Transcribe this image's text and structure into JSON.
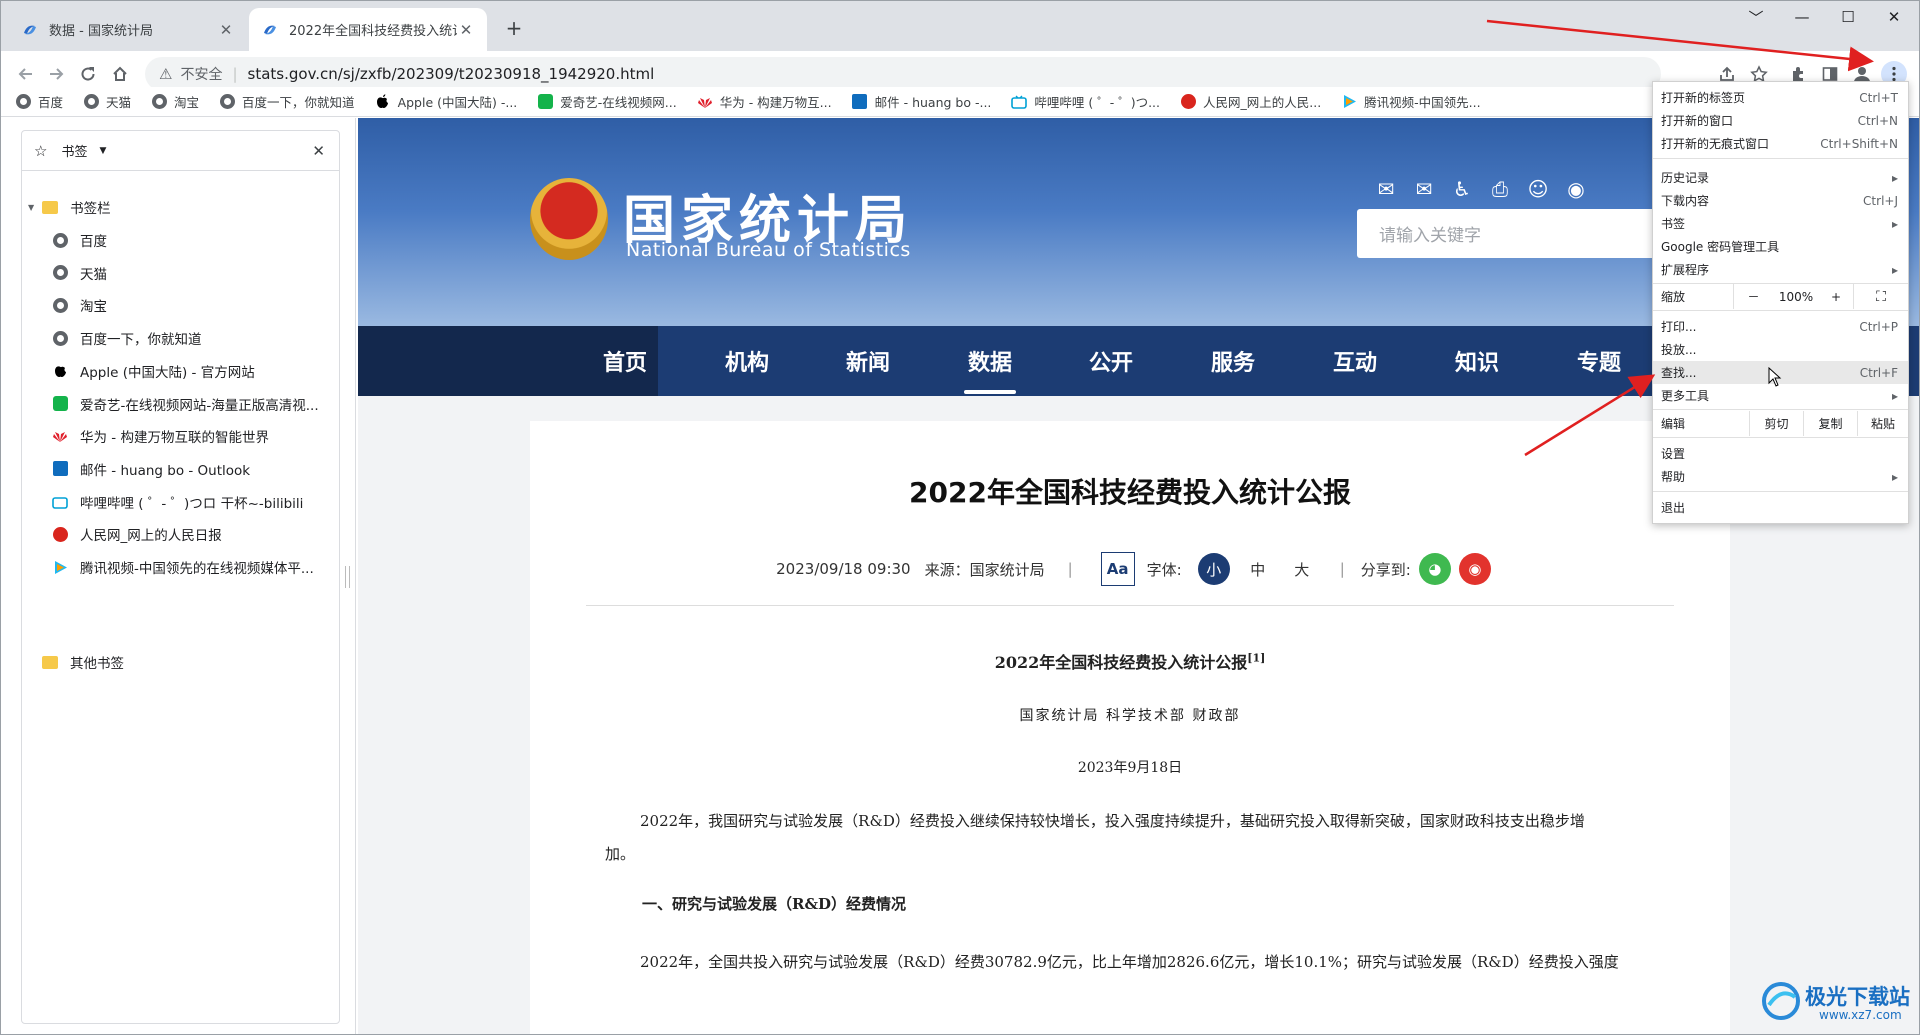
{
  "tabs": [
    {
      "title": "数据 - 国家统计局",
      "close": "✕"
    },
    {
      "title": "2022年全国科技经费投入统计公",
      "close": "✕"
    }
  ],
  "new_tab": "+",
  "window_controls": {
    "minimize": "﹀",
    "restore": "—",
    "maximize": "☐",
    "close": "✕"
  },
  "address_bar": {
    "warning": "⚠",
    "insecure": "不安全",
    "url": "stats.gov.cn/sj/zxfb/202309/t20230918_1942920.html"
  },
  "bookmarks_bar": [
    "百度",
    "天猫",
    "淘宝",
    "百度一下，你就知道",
    "Apple (中国大陆) -...",
    "爱奇艺-在线视频网...",
    "华为 - 构建万物互...",
    "邮件 - huang bo -...",
    "哔哩哔哩 ( ゜- ゜)つ...",
    "人民网_网上的人民...",
    "腾讯视频-中国领先..."
  ],
  "side_panel": {
    "header": "书签",
    "close": "✕",
    "folder": "书签栏",
    "items": [
      "百度",
      "天猫",
      "淘宝",
      "百度一下，你就知道",
      "Apple (中国大陆) - 官方网站",
      "爱奇艺-在线视频网站-海量正版高清视...",
      "华为 - 构建万物互联的智能世界",
      "邮件 - huang bo - Outlook",
      "哔哩哔哩 ( ゜- ゜)つロ 干杯~-bilibili",
      "人民网_网上的人民日报",
      "腾讯视频-中国领先的在线视频媒体平..."
    ],
    "other": "其他书签"
  },
  "site": {
    "logo_cn": "国家统计局",
    "logo_en": "National Bureau of Statistics",
    "search_placeholder": "请输入关键字",
    "nav": [
      "首页",
      "机构",
      "新闻",
      "数据",
      "公开",
      "服务",
      "互动",
      "知识",
      "专题"
    ]
  },
  "article": {
    "title": "2022年全国科技经费投入统计公报",
    "date": "2023/09/18 09:30",
    "source": "来源：国家统计局",
    "divider": "|",
    "aa": "Aa",
    "font_label": "字体:",
    "font_small": "小",
    "font_mid": "中",
    "font_large": "大",
    "share_label": "分享到:",
    "body_title": "2022年全国科技经费投入统计公报",
    "body_title_note": "[1]",
    "authors": "国家统计局 科学技术部 财政部",
    "body_date": "2023年9月18日",
    "para1": "2022年，我国研究与试验发展（R&D）经费投入继续保持较快增长，投入强度持续提升，基础研究投入取得新突破，国家财政科技支出稳步增",
    "para1_end": "加。",
    "section1": "一、研究与试验发展（R&D）经费情况",
    "para2": "2022年，全国共投入研究与试验发展（R&D）经费30782.9亿元，比上年增加2826.6亿元，增长10.1%；研究与试验发展（R&D）经费投入强度"
  },
  "menu": {
    "new_tab": {
      "label": "打开新的标签页",
      "shortcut": "Ctrl+T"
    },
    "new_window": {
      "label": "打开新的窗口",
      "shortcut": "Ctrl+N"
    },
    "incognito": {
      "label": "打开新的无痕式窗口",
      "shortcut": "Ctrl+Shift+N"
    },
    "history": {
      "label": "历史记录",
      "shortcut": "▸"
    },
    "downloads": {
      "label": "下载内容",
      "shortcut": "Ctrl+J"
    },
    "bookmarks": {
      "label": "书签",
      "shortcut": "▸"
    },
    "passwords": {
      "label": "Google 密码管理工具"
    },
    "extensions": {
      "label": "扩展程序",
      "shortcut": "▸"
    },
    "zoom": {
      "label": "缩放",
      "minus": "－",
      "value": "100%",
      "plus": "+",
      "full": "⛶"
    },
    "print": {
      "label": "打印...",
      "shortcut": "Ctrl+P"
    },
    "cast": {
      "label": "投放..."
    },
    "find": {
      "label": "查找...",
      "shortcut": "Ctrl+F"
    },
    "more_tools": {
      "label": "更多工具",
      "shortcut": "▸"
    },
    "edit": {
      "label": "编辑",
      "cut": "剪切",
      "copy": "复制",
      "paste": "粘贴"
    },
    "settings": {
      "label": "设置"
    },
    "help": {
      "label": "帮助",
      "shortcut": "▸"
    },
    "exit": {
      "label": "退出"
    }
  },
  "watermark": {
    "cn": "极光下载站",
    "url": "www.xz7.com"
  },
  "colors": {
    "accent": "#1c3c73",
    "arrow": "#e02020"
  }
}
